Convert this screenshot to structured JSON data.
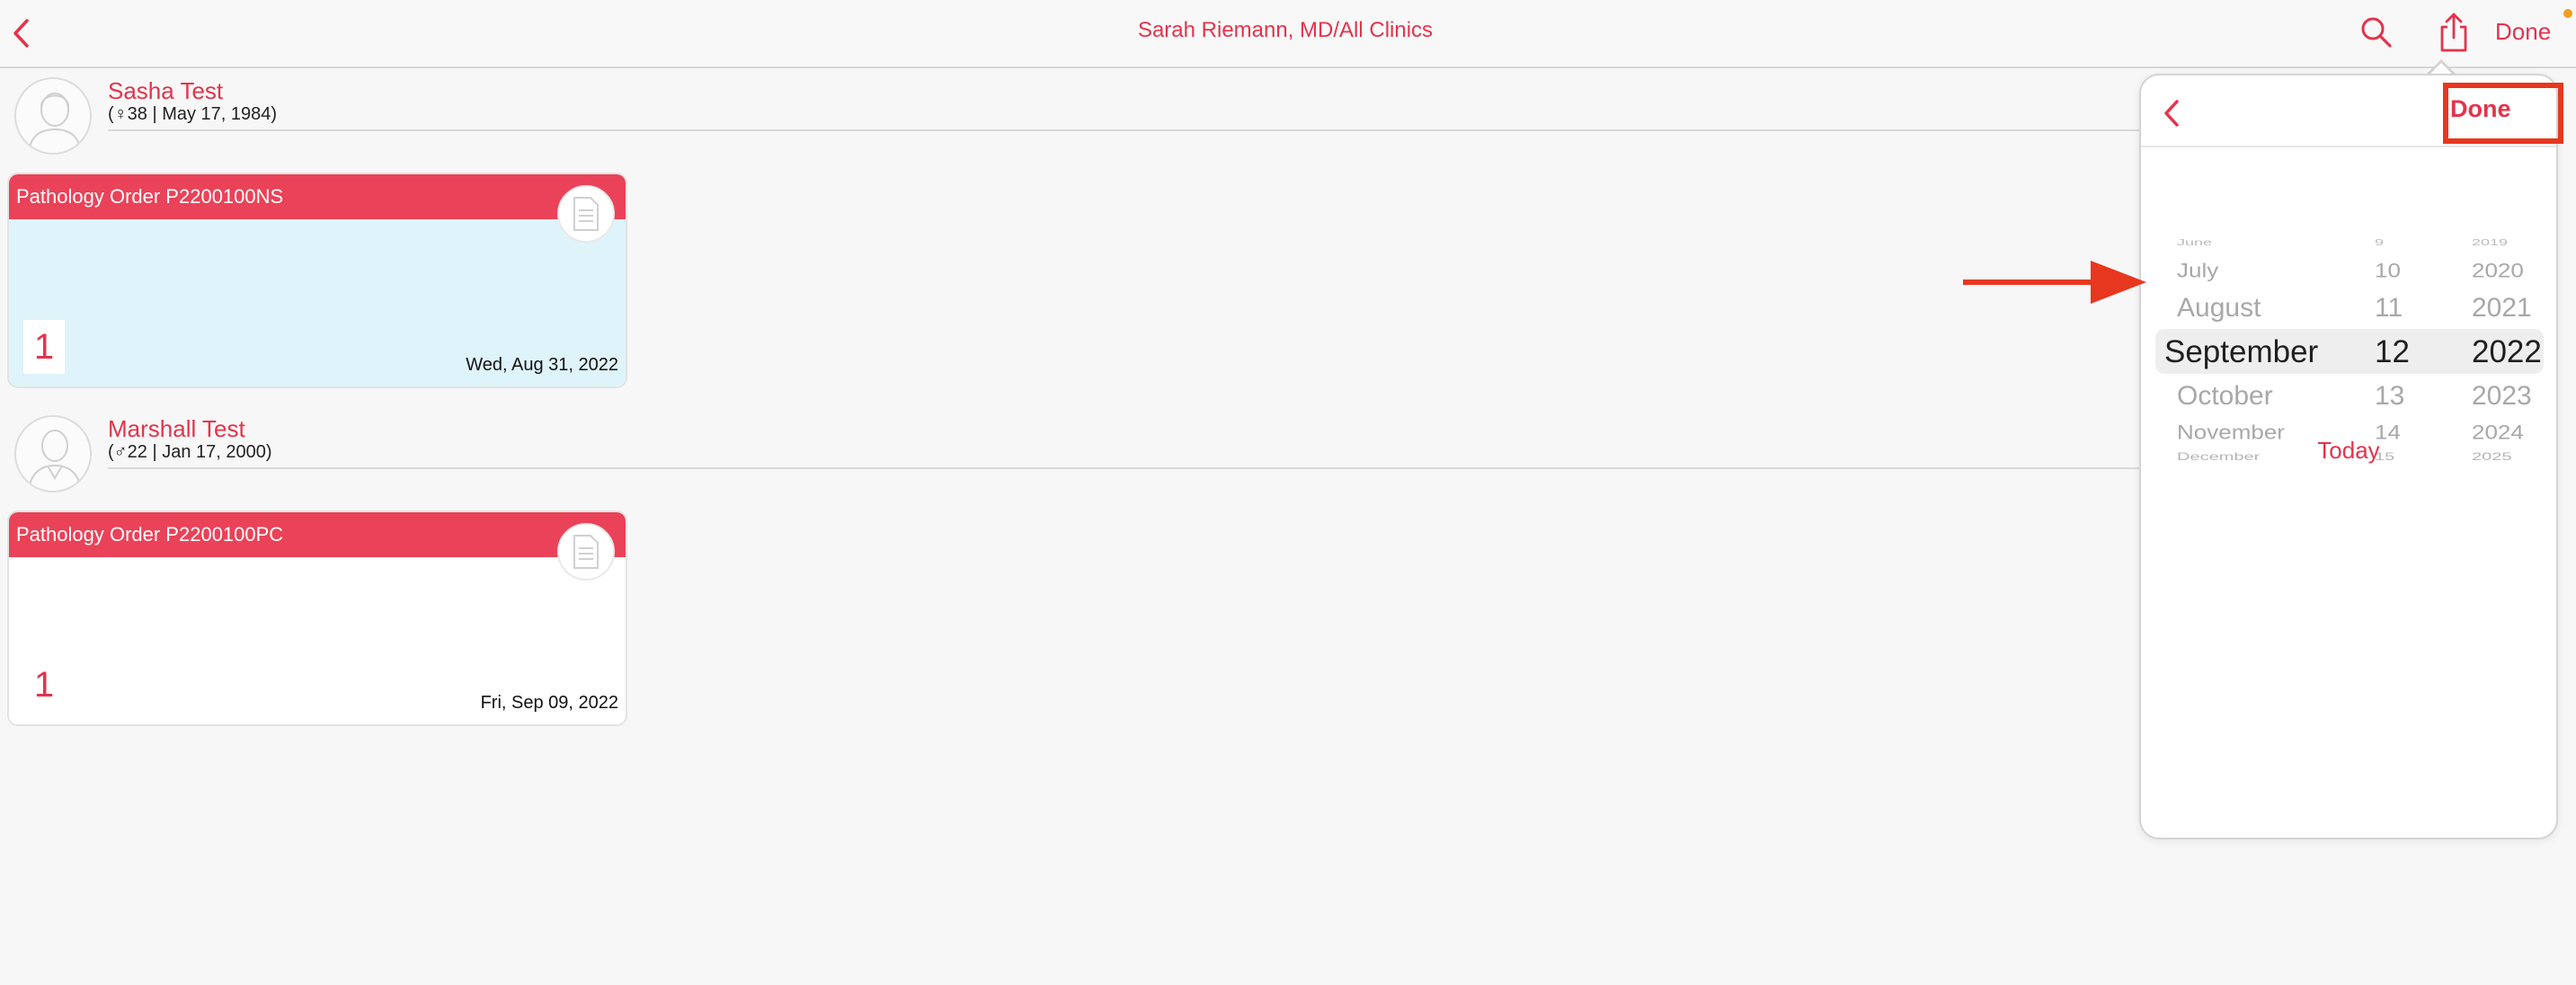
{
  "nav": {
    "title": "Sarah Riemann, MD/All Clinics",
    "done_label": "Done",
    "back_icon": "chevron-left-icon",
    "search_icon": "search-icon",
    "share_icon": "share-icon"
  },
  "patients": [
    {
      "name": "Sasha Test",
      "info": "(♀38 | May 17, 1984)",
      "order": {
        "title": "Pathology Order P2200100NS",
        "count": "1",
        "date": "Wed, Aug 31, 2022"
      }
    },
    {
      "name": "Marshall Test",
      "info": "(♂22 | Jan 17, 2000)",
      "order": {
        "title": "Pathology Order P2200100PC",
        "count": "1",
        "date": "Fri, Sep 09, 2022"
      }
    }
  ],
  "picker": {
    "done_label": "Done",
    "today_label": "Today",
    "rows": [
      {
        "month": "June",
        "day": "9",
        "year": "2019"
      },
      {
        "month": "July",
        "day": "10",
        "year": "2020"
      },
      {
        "month": "August",
        "day": "11",
        "year": "2021"
      },
      {
        "month": "September",
        "day": "12",
        "year": "2022"
      },
      {
        "month": "October",
        "day": "13",
        "year": "2023"
      },
      {
        "month": "November",
        "day": "14",
        "year": "2024"
      },
      {
        "month": "December",
        "day": "15",
        "year": "2025"
      }
    ],
    "selected": {
      "month": "September",
      "day": "12",
      "year": "2022"
    }
  },
  "colors": {
    "accent": "#e5334b",
    "card_header": "#ea4258",
    "card_tint": "#dff3fb",
    "annotation": "#e8371f"
  }
}
